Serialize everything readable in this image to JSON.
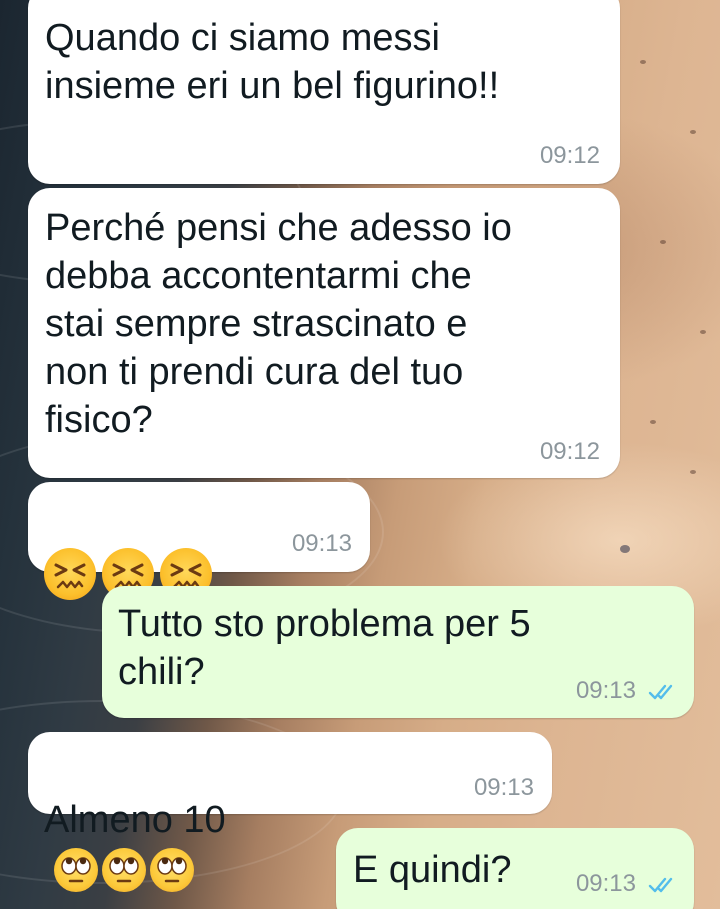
{
  "chat": {
    "colors": {
      "incoming_bubble": "#ffffff",
      "outgoing_bubble": "#e7ffdb",
      "read_ticks": "#53bdeb",
      "timestamp": "#8c969c"
    },
    "messages": [
      {
        "direction": "incoming",
        "text": "Quando ci siamo messi\ninsieme eri un bel figurino!!",
        "time": "09:12"
      },
      {
        "direction": "incoming",
        "text": "Perché pensi che adesso io\ndebba accontentarmi che\nstai sempre strascinato e\nnon ti prendi cura del tuo\nfisico?",
        "time": "09:12"
      },
      {
        "direction": "incoming",
        "emoji": "confounded-face ×3",
        "time": "09:13"
      },
      {
        "direction": "outgoing",
        "text": "Tutto sto problema per 5\nchili?",
        "time": "09:13",
        "status": "read"
      },
      {
        "direction": "incoming",
        "text": "Almeno 10",
        "emoji": "face-with-rolling-eyes ×3",
        "time": "09:13"
      },
      {
        "direction": "outgoing",
        "text": "E quindi?",
        "time": "09:13",
        "status": "read"
      }
    ]
  }
}
